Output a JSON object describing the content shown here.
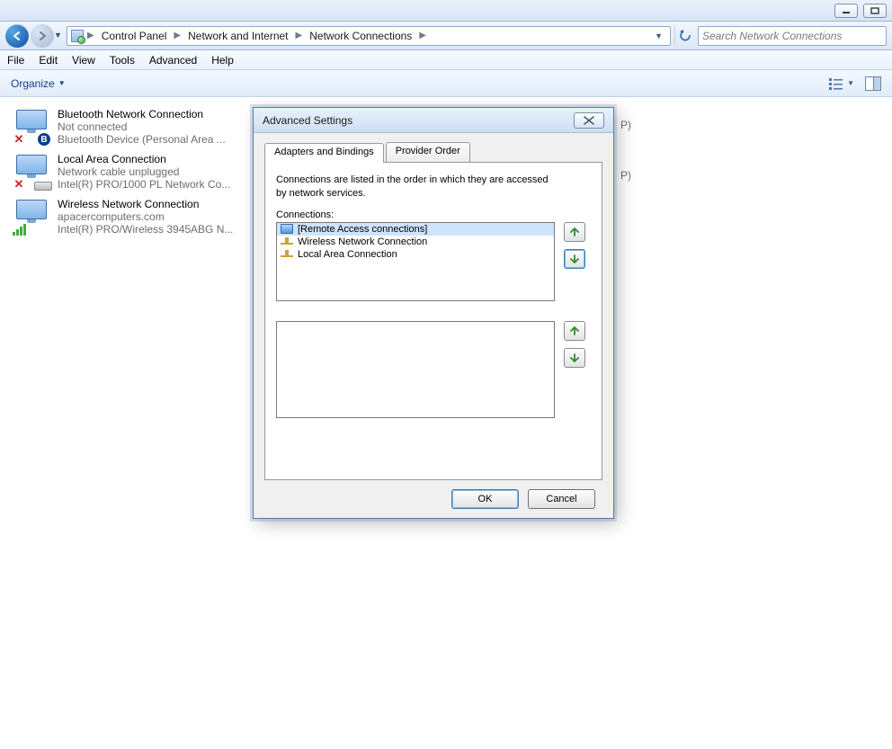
{
  "breadcrumbs": [
    "Control Panel",
    "Network and Internet",
    "Network Connections"
  ],
  "search_placeholder": "Search Network Connections",
  "menu": [
    "File",
    "Edit",
    "View",
    "Tools",
    "Advanced",
    "Help"
  ],
  "toolbar": {
    "organize": "Organize"
  },
  "connections": [
    {
      "title": "Bluetooth Network Connection",
      "line2": "Not connected",
      "line3": "Bluetooth Device (Personal Area ..."
    },
    {
      "title": "Local Area Connection",
      "line2": "Network cable unplugged",
      "line3": "Intel(R) PRO/1000 PL Network Co..."
    },
    {
      "title": "Wireless Network Connection",
      "line2": "apacercomputers.com",
      "line3": "Intel(R) PRO/Wireless 3945ABG N..."
    }
  ],
  "peek": "P)",
  "dialog": {
    "title": "Advanced Settings",
    "tabs": [
      "Adapters and Bindings",
      "Provider Order"
    ],
    "description": "Connections are listed in the order in which they are accessed by network services.",
    "connections_label": "Connections:",
    "list": [
      "[Remote Access connections]",
      "Wireless Network Connection",
      "Local Area Connection"
    ],
    "ok": "OK",
    "cancel": "Cancel"
  }
}
